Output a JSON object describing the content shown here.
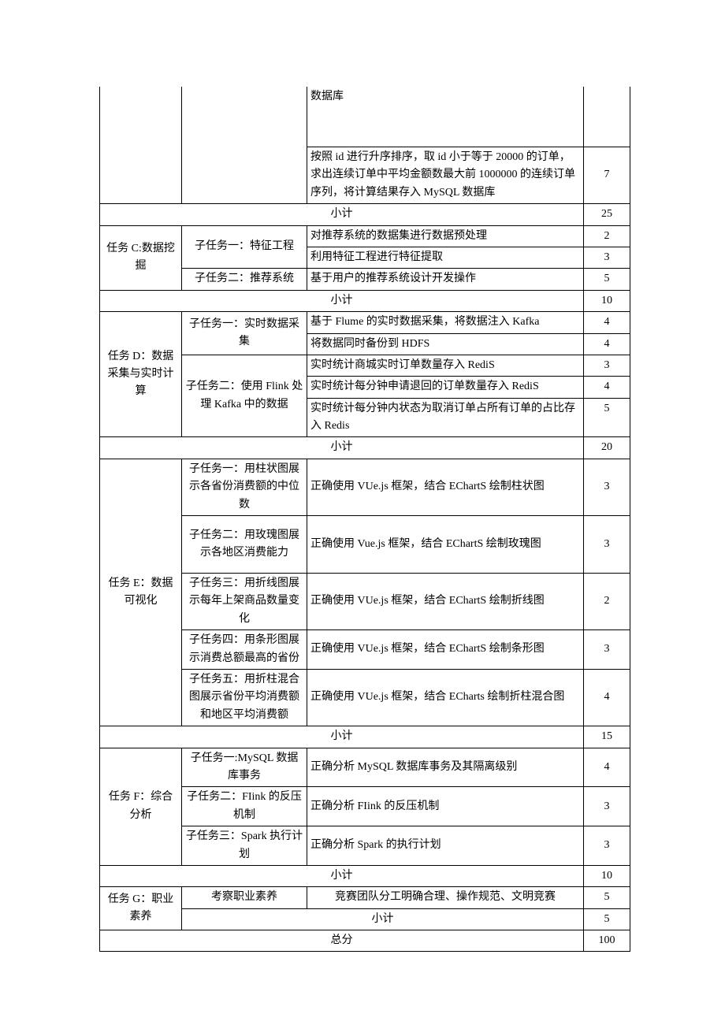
{
  "labels": {
    "subtotal": "小计",
    "total": "总分"
  },
  "taskB_partial": {
    "row1_desc": "数据库",
    "row2_desc": "按照 id 进行升序排序，取 id 小于等于 20000 的订单，求出连续订单中平均金额数最大前 1000000 的连续订单序列，将计算结果存入 MySQL 数据库",
    "row2_score": "7",
    "subtotal": "25"
  },
  "taskC": {
    "name": "任务 C:数据挖掘",
    "sub1": "子任务一：特征工程",
    "sub1_r1_desc": "对推荐系统的数据集进行数据预处理",
    "sub1_r1_score": "2",
    "sub1_r2_desc": "利用特征工程进行特征提取",
    "sub1_r2_score": "3",
    "sub2": "子任务二：推荐系统",
    "sub2_r1_desc": "基于用户的推荐系统设计开发操作",
    "sub2_r1_score": "5",
    "subtotal": "10"
  },
  "taskD": {
    "name": "任务 D：数据采集与实时计算",
    "sub1": "子任务一：实时数据采集",
    "sub1_r1_desc": "基于 Flume 的实时数据采集，将数据注入 Kafka",
    "sub1_r1_score": "4",
    "sub1_r2_desc": "将数据同时备份到 HDFS",
    "sub1_r2_score": "4",
    "sub2": "子任务二：使用 Flink 处理 Kafka 中的数据",
    "sub2_r1_desc": "实时统计商城实时订单数量存入 RediS",
    "sub2_r1_score": "3",
    "sub2_r2_desc": "实时统计每分钟申请退回的订单数量存入 RediS",
    "sub2_r2_score": "4",
    "sub2_r3_desc": "实时统计每分钟内状态为取消订单占所有订单的占比存入 Redis",
    "sub2_r3_score": "5",
    "subtotal": "20"
  },
  "taskE": {
    "name": "任务 E：数据可视化",
    "sub1": "子任务一：用柱状图展示各省份消费额的中位数",
    "sub1_desc": "正确使用 VUe.js 框架，结合 EChartS 绘制柱状图",
    "sub1_score": "3",
    "sub2": "子任务二：用玫瑰图展示各地区消费能力",
    "sub2_desc": "正确使用 Vue.js 框架，结合 EChartS 绘制玫瑰图",
    "sub2_score": "3",
    "sub3": "子任务三：用折线图展示每年上架商品数量变化",
    "sub3_desc": "正确使用 VUe.js 框架，结合 EChartS 绘制折线图",
    "sub3_score": "2",
    "sub4": "子任务四：用条形图展示消费总额最高的省份",
    "sub4_desc": "正确使用 VUe.js 框架，结合 EChartS 绘制条形图",
    "sub4_score": "3",
    "sub5": "子任务五：用折柱混合图展示省份平均消费额和地区平均消费额",
    "sub5_desc": "正确使用 VUe.js 框架，结合 ECharts 绘制折柱混合图",
    "sub5_score": "4",
    "subtotal": "15"
  },
  "taskF": {
    "name": "任务 F：综合分析",
    "sub1": "子任务一:MySQL 数据库事务",
    "sub1_desc": "正确分析 MySQL 数据库事务及其隔离级别",
    "sub1_score": "4",
    "sub2": "子任务二：FIink 的反压机制",
    "sub2_desc": "正确分析 FIink 的反压机制",
    "sub2_score": "3",
    "sub3": "子任务三：Spark 执行计划",
    "sub3_desc": "正确分析 Spark 的执行计划",
    "sub3_score": "3",
    "subtotal": "10"
  },
  "taskG": {
    "name": "任务 G：职业素养",
    "sub1": "考察职业素养",
    "sub1_desc": "竞赛团队分工明确合理、操作规范、文明竞赛",
    "sub1_score": "5",
    "subtotal": "5"
  },
  "total": "100"
}
